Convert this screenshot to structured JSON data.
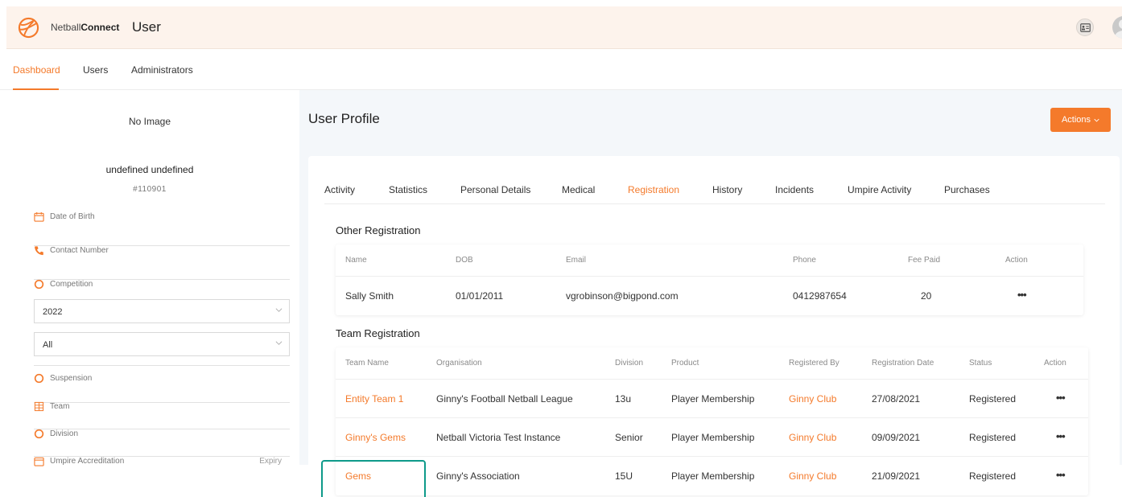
{
  "header": {
    "brand_prefix": "Netball",
    "brand_suffix": "Connect",
    "page_title": "User",
    "icons": [
      "netball-logo-icon",
      "id-card-icon",
      "user-avatar-icon"
    ],
    "accent_color": "#f47a2b"
  },
  "nav": {
    "items": [
      {
        "label": "Dashboard",
        "active": true
      },
      {
        "label": "Users",
        "active": false
      },
      {
        "label": "Administrators",
        "active": false
      }
    ]
  },
  "left_panel": {
    "no_image": "No Image",
    "user_name": "undefined undefined",
    "user_id": "#110901",
    "date_of_birth_label": "Date of Birth",
    "contact_number_label": "Contact Number",
    "competition_label": "Competition",
    "competition_select": "2022",
    "second_select": "All",
    "suspension_label": "Suspension",
    "team_label": "Team",
    "division_label": "Division",
    "umpire_accreditation_label": "Umpire Accreditation",
    "expiry_label": "Expiry"
  },
  "main": {
    "title": "User Profile",
    "actions_label": "Actions",
    "tabs": [
      {
        "label": "Activity",
        "active": false
      },
      {
        "label": "Statistics",
        "active": false
      },
      {
        "label": "Personal Details",
        "active": false
      },
      {
        "label": "Medical",
        "active": false
      },
      {
        "label": "Registration",
        "active": true
      },
      {
        "label": "History",
        "active": false
      },
      {
        "label": "Incidents",
        "active": false
      },
      {
        "label": "Umpire Activity",
        "active": false
      },
      {
        "label": "Purchases",
        "active": false
      }
    ],
    "other_registration": {
      "title": "Other Registration",
      "columns": [
        "Name",
        "DOB",
        "Email",
        "Phone",
        "Fee Paid",
        "Action"
      ],
      "rows": [
        {
          "name": "Sally Smith",
          "dob": "01/01/2011",
          "email": "vgrobinson@bigpond.com",
          "phone": "0412987654",
          "fee_paid": "20",
          "action": "•••"
        }
      ]
    },
    "team_registration": {
      "title": "Team Registration",
      "columns": [
        "Team Name",
        "Organisation",
        "Division",
        "Product",
        "Registered By",
        "Registration Date",
        "Status",
        "Action"
      ],
      "rows": [
        {
          "team_name": "Entity Team 1",
          "organisation": "Ginny's Football Netball League",
          "division": "13u",
          "product": "Player Membership",
          "registered_by": "Ginny Club",
          "registration_date": "27/08/2021",
          "status": "Registered",
          "action": "•••"
        },
        {
          "team_name": "Ginny's Gems",
          "organisation": "Netball Victoria Test Instance",
          "division": "Senior",
          "product": "Player Membership",
          "registered_by": "Ginny Club",
          "registration_date": "09/09/2021",
          "status": "Registered",
          "action": "•••"
        },
        {
          "team_name": "Gems",
          "organisation": "Ginny's Association",
          "division": "15U",
          "product": "Player Membership",
          "registered_by": "Ginny Club",
          "registration_date": "21/09/2021",
          "status": "Registered",
          "action": "•••"
        }
      ]
    }
  }
}
